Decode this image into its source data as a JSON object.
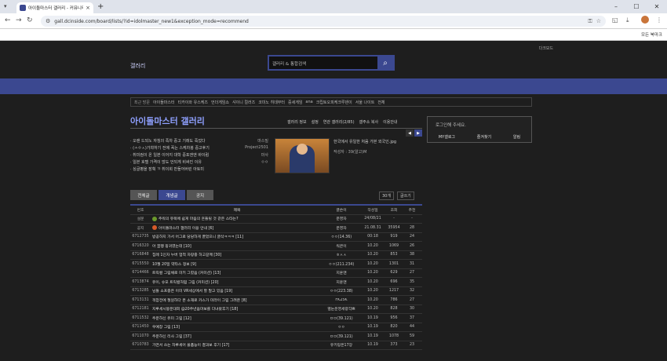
{
  "browser": {
    "tab_title": "아이돌마스터 갤러리 - 커뮤니티",
    "url": "gall.dcinside.com/board/lists/?id=idolmaster_new1&exception_mode=recommend",
    "all_bookmarks": "모든 북마크"
  },
  "site": {
    "dark_mode": "다크모드",
    "logo": "갤러리",
    "search_placeholder": "갤러리 & 통합검색"
  },
  "recent": {
    "label": "최근 방문",
    "items": [
      "아이돌마스터",
      "티카이와 유스케즈",
      "언더게임쇼",
      "샤이니 컬러즈",
      "코미노 히데부터",
      "중세게임",
      "ana",
      "크립토오피케크루덴이",
      "서울 나이트"
    ],
    "all": "전체"
  },
  "gallery": {
    "title": "아이돌마스터 갤러리",
    "menu": [
      "갤러리 정보",
      "설정",
      "연관 갤러리(2/85)",
      "갤주소 복사",
      "이용안내"
    ]
  },
  "notices": [
    {
      "t": "· 오랜 드되노 자칭의 족차 중고 기래도 죽었다",
      "a": "마스빌"
    },
    {
      "t": "· (ㅗㅇㅅ)가챠하기 전에 꼭는 스케차붕 중고후기",
      "a": "Project2501"
    },
    {
      "t": "· 취미컴이 온 일본 이어지 대학 중포앤앤 바이럼",
      "a": "마사"
    },
    {
      "t": "· 일본 호텔 가격이 많도 언되게 비싸진 이유",
      "a": "ㅇㅇ"
    },
    {
      "t": "· 싱글평을 장획 ㄲ 취이회 만들어버린 아토미",
      "a": ""
    }
  ],
  "featured": {
    "title": "한국에서 유일한 처음 가본 외국인.jpg",
    "sub": "작성자 : 39(알고)M"
  },
  "login": {
    "msg": "로그인해 주세요.",
    "links": [
      "MY갤로그",
      "즐겨찾기",
      "알림"
    ]
  },
  "board": {
    "tabs": [
      "전체글",
      "개념글",
      "공지"
    ],
    "count": "30개",
    "write": "글쓰기",
    "headers": [
      "번호",
      "제목",
      "글쓴이",
      "작성일",
      "조회",
      "추천"
    ],
    "rows": [
      {
        "no": "설문",
        "icon": "g",
        "title": "주워의 유목에 쉽게 마음의 흔들릴 것 같은 스타는?",
        "writer": "운영자",
        "date": "24/08/21",
        "views": "-",
        "rec": "-"
      },
      {
        "no": "공지",
        "icon": "o",
        "title": "아이돌마스터 갤러리 이용 안내 [6]",
        "writer": "운영자",
        "date": "21.08.31",
        "views": "35954",
        "rec": "28"
      },
      {
        "no": "6712735",
        "title": "방공하지 가서 어그로 당당하게 끌었으니 글삭ㅋㅋㅋ [11]",
        "writer": "ㅇㅇ(14.36)",
        "date": "00:18",
        "views": "919",
        "rec": "24"
      },
      {
        "no": "6716320",
        "title": "아 꿈쨍 핑귀였는데 [10]",
        "writer": "씩큰이",
        "date": "10.20",
        "views": "1069",
        "rec": "26"
      },
      {
        "no": "6716848",
        "title": "집례 1인자 누버 업적 자랑중 하고갈께 [30]",
        "writer": "ㅎㅅㅅ",
        "date": "10.20",
        "views": "853",
        "rec": "38"
      },
      {
        "no": "6715550",
        "title": "10월 20일 약타스 정보 [9]",
        "writer": "ㅇㅇ(211.234)",
        "date": "10.20",
        "views": "1301",
        "rec": "31"
      },
      {
        "no": "6714466",
        "title": "트릭컬 그림채로 미키 그렸음 (커미션) [13]",
        "writer": "지훈맨",
        "date": "10.20",
        "views": "629",
        "rec": "27"
      },
      {
        "no": "6713874",
        "title": "유이, 슈포 트릭컬처럼 그림 (커미션) [20]",
        "writer": "지훈맨",
        "date": "10.20",
        "views": "696",
        "rec": "35"
      },
      {
        "no": "6713285",
        "title": "님들 소프중은 이미 VR세상에서 할 말고 있음 [19]",
        "writer": "ㅇㅇ(223.38)",
        "date": "10.20",
        "views": "1217",
        "rec": "32"
      },
      {
        "no": "6713131",
        "title": "객잡전에 절원하다 본 소재로 카스가 미라이 그림 그려온 [8]",
        "writer": "FK25K",
        "date": "10.20",
        "views": "786",
        "rec": "27"
      },
      {
        "no": "6712181",
        "title": "지루세시봉운대회 @20주년옴마보를 다녀왔후기 [18]",
        "writer": "별눈운영세량각쁘",
        "date": "10.20",
        "views": "828",
        "rec": "30"
      },
      {
        "no": "6711532",
        "title": "주운하신 유미 그림 [12]",
        "writer": "ㅁㅁ(39.121)",
        "date": "10.19",
        "views": "956",
        "rec": "37"
      },
      {
        "no": "6711450",
        "title": "우예창 그림 [13]",
        "writer": "ㅇㅇ",
        "date": "10.19",
        "views": "820",
        "rec": "44"
      },
      {
        "no": "6711070",
        "title": "주운하신 리사 그림 [37]",
        "writer": "ㅁㅁ(39.121)",
        "date": "10.19",
        "views": "1078",
        "rec": "59"
      },
      {
        "no": "6710783",
        "title": "가면서 쓰는 차루세어 물품능이 결과보 후기 [17]",
        "writer": "유키링온17장",
        "date": "10.19",
        "views": "373",
        "rec": "23"
      }
    ]
  }
}
